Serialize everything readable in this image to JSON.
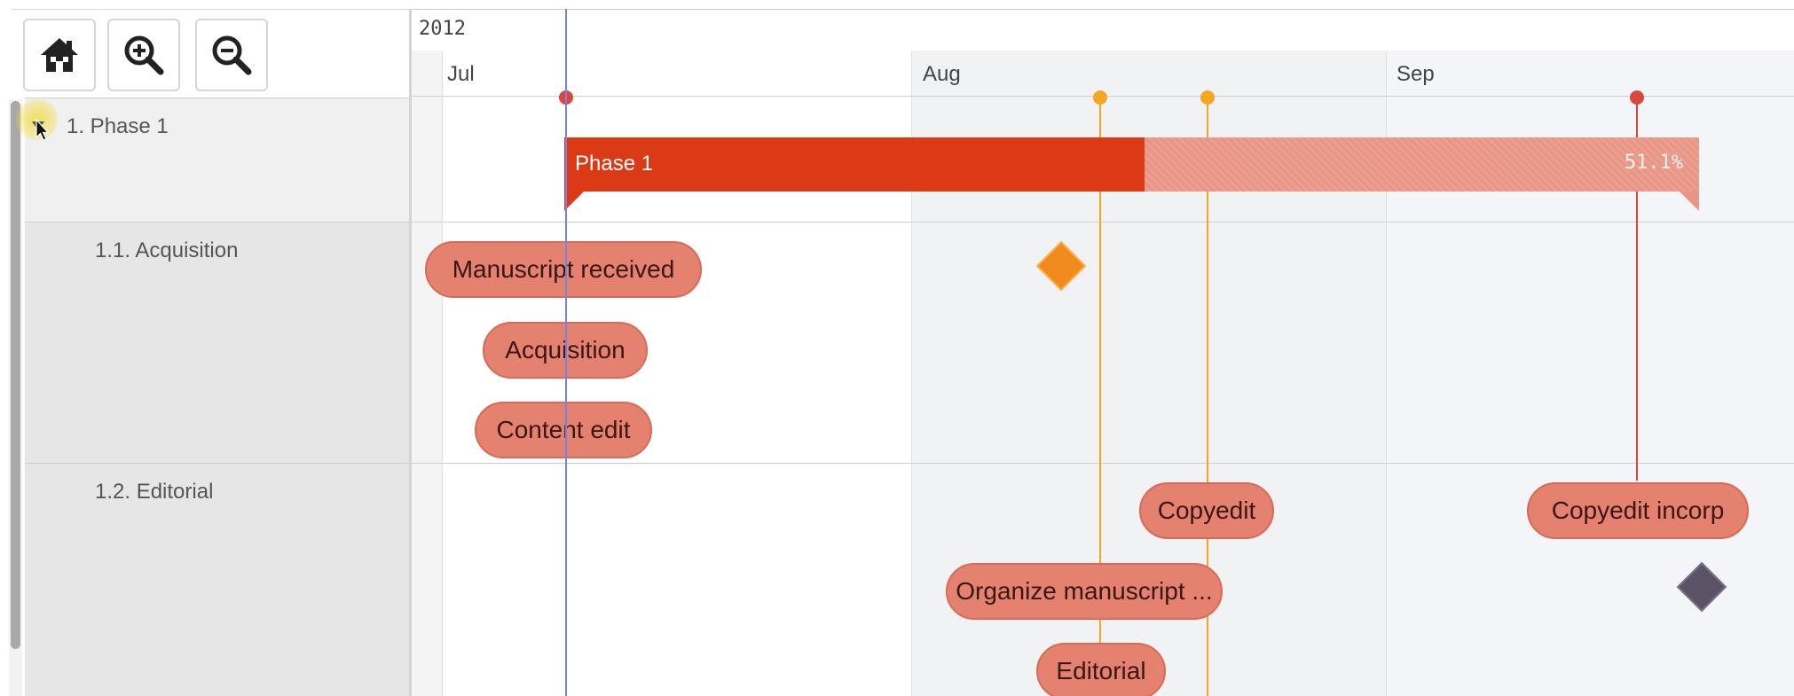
{
  "toolbar": {
    "buttons": [
      {
        "name": "home",
        "icon": "home-icon"
      },
      {
        "name": "zoom-in",
        "icon": "zoom-in-icon"
      },
      {
        "name": "zoom-out",
        "icon": "zoom-out-icon"
      }
    ]
  },
  "tree": {
    "rows": [
      {
        "label": "1. Phase 1",
        "expander_icon": "collapse-triangle-icon"
      },
      {
        "label": "1.1. Acquisition"
      },
      {
        "label": "1.2. Editorial"
      }
    ]
  },
  "timeline": {
    "year": "2012",
    "months": [
      "Jul",
      "Aug",
      "Sep"
    ]
  },
  "phase_bar": {
    "title": "Phase 1",
    "progress_label": "51.1%",
    "progress": 0.511
  },
  "tasks": {
    "acquisition": [
      "Manuscript received",
      "Acquisition",
      "Content edit"
    ],
    "editorial": [
      "Copyedit",
      "Copyedit incorp",
      "Organize manuscript ...",
      "Editorial"
    ]
  },
  "colors": {
    "phase_done": "#dc3a16",
    "phase_remaining": "#e99585",
    "task_pill": "#e5816f",
    "today_line": "#6f86e8",
    "dependency_orange": "#f5a623",
    "dependency_red": "#d9483b",
    "milestone_orange": "#f08a1c",
    "milestone_dark": "#5b5266"
  }
}
